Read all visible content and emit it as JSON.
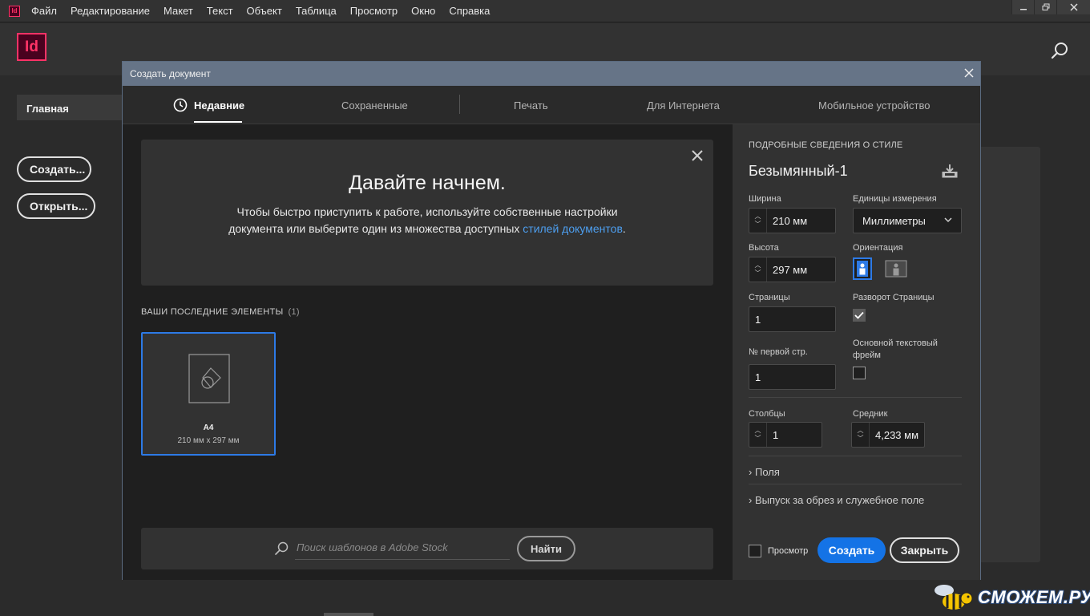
{
  "menubar": {
    "app_icon": "Id",
    "items": [
      "Файл",
      "Редактирование",
      "Макет",
      "Текст",
      "Объект",
      "Таблица",
      "Просмотр",
      "Окно",
      "Справка"
    ]
  },
  "appbar": {
    "logo": "Id"
  },
  "sidebar": {
    "home_tab": "Главная",
    "create_button": "Создать...",
    "open_button": "Открыть..."
  },
  "dialog": {
    "title": "Создать документ",
    "tabs": [
      {
        "label": "Недавние",
        "active": true
      },
      {
        "label": "Сохраненные",
        "active": false
      },
      {
        "label": "Печать",
        "active": false
      },
      {
        "label": "Для Интернета",
        "active": false
      },
      {
        "label": "Мобильное устройство",
        "active": false
      }
    ],
    "welcome": {
      "heading": "Давайте начнем.",
      "text_part1": "Чтобы быстро приступить к работе, используйте собственные настройки документа или выберите один из множества доступных ",
      "text_link": "стилей документов",
      "text_part2": "."
    },
    "recent": {
      "heading": "ВАШИ ПОСЛЕДНИЕ ЭЛЕМЕНТЫ",
      "count": "(1)",
      "items": [
        {
          "name": "A4",
          "size": "210 мм x 297 мм"
        }
      ]
    },
    "stock_search": {
      "placeholder": "Поиск шаблонов в Adobe Stock",
      "button": "Найти"
    },
    "details": {
      "heading": "ПОДРОБНЫЕ СВЕДЕНИЯ О СТИЛЕ",
      "name": "Безымянный-1",
      "width_label": "Ширина",
      "width_value": "210 мм",
      "units_label": "Единицы измерения",
      "units_value": "Миллиметры",
      "height_label": "Высота",
      "height_value": "297 мм",
      "orientation_label": "Ориентация",
      "orientation_selected": "portrait",
      "pages_label": "Страницы",
      "pages_value": "1",
      "facing_label": "Разворот Страницы",
      "facing_checked": true,
      "start_label": "№ первой стр.",
      "start_value": "1",
      "primary_frame_label": "Основной текстовый фрейм",
      "primary_frame_checked": false,
      "columns_label": "Столбцы",
      "columns_value": "1",
      "gutter_label": "Средник",
      "gutter_value": "4,233 мм",
      "margins_label": "Поля",
      "bleed_label": "Выпуск за обрез и служебное поле",
      "preview_label": "Просмотр",
      "preview_checked": false,
      "create_button": "Создать",
      "close_button": "Закрыть"
    }
  },
  "watermark": {
    "text": "СМОЖЕМ.РУ"
  },
  "colors": {
    "accent": "#1473e6",
    "brand": "#ff3366",
    "link": "#4d9ff0",
    "title_bar": "#667487"
  }
}
